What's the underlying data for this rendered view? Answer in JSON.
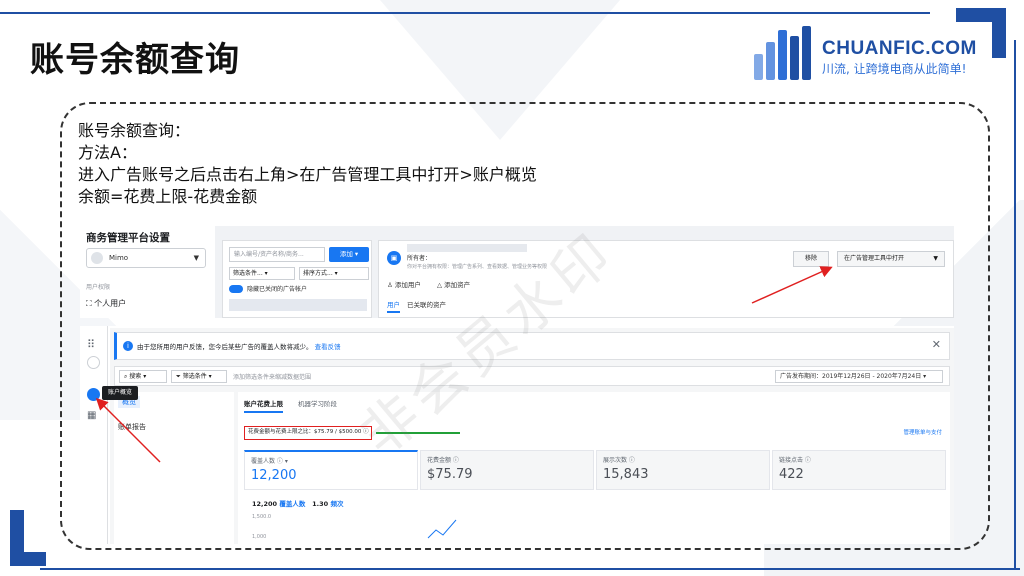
{
  "slide": {
    "title": "账号余额查询",
    "logo": {
      "name": "CHUANFIC.COM",
      "slogan": "川流, 让跨境电商从此简单!"
    },
    "description": [
      "账号余额查询：",
      "方法A：",
      "进入广告账号之后点击右上角>在广告管理工具中打开>账户概览",
      "余额=花费上限-花费金额"
    ],
    "watermark": "非会员水印"
  },
  "business_settings": {
    "title": "商务管理平台设置",
    "account_select": "Mimo",
    "section_label": "用户权限",
    "people_item": "个人用户",
    "search_placeholder": "输入编号/资产名称/商务...",
    "add_button": "添加",
    "filter_label": "筛选条件...",
    "sort_label": "排序方式...",
    "toggle_label": "隐藏已关闭的广告帐户",
    "owner_label": "所有者：",
    "permissions_text": "你对平台拥有权限：管理广告系列、查看数据、管理业务等权限",
    "add_user": "添加用户",
    "add_asset": "添加资产",
    "tab_users": "用户",
    "tab_linked": "已关联的资产",
    "remove_button": "移除",
    "open_in_ads_manager": "在广告管理工具中打开"
  },
  "ads_manager": {
    "tooltip": "账户概览",
    "notice_text": "由于您所用的用户反馈，您今后某些广告的覆盖人数将减少。",
    "notice_link": "查看反馈",
    "search_label": "搜索",
    "filter_label": "筛选条件",
    "filter_hint": "添加筛选条件来缩减数据范围",
    "date_range": "广告发布期间：2019年12月26日 - 2020年7月24日",
    "nav_overview": "概览",
    "nav_report": "账单报告",
    "tab_spend_limit": "账户花费上限",
    "tab_learning": "机器学习阶段",
    "spend_ratio": "花费金额与花费上限之比：$75.79 / $500.00",
    "manage_link": "管理账单与支付",
    "metrics": [
      {
        "label": "覆盖人数",
        "value": "12,200"
      },
      {
        "label": "花费金额",
        "value": "$75.79"
      },
      {
        "label": "展示次数",
        "value": "15,843"
      },
      {
        "label": "链接点击",
        "value": "422"
      }
    ],
    "legend_reach_value": "12,200",
    "legend_reach_label": "覆盖人数",
    "legend_freq_value": "1.30",
    "legend_freq_label": "频次",
    "y_ticks": [
      "1,500.0",
      "1,000"
    ]
  },
  "colors": {
    "brand_blue": "#1f4fa3",
    "fb_blue": "#1877f2",
    "annotation_red": "#e02020",
    "annotation_green": "#21a038"
  }
}
